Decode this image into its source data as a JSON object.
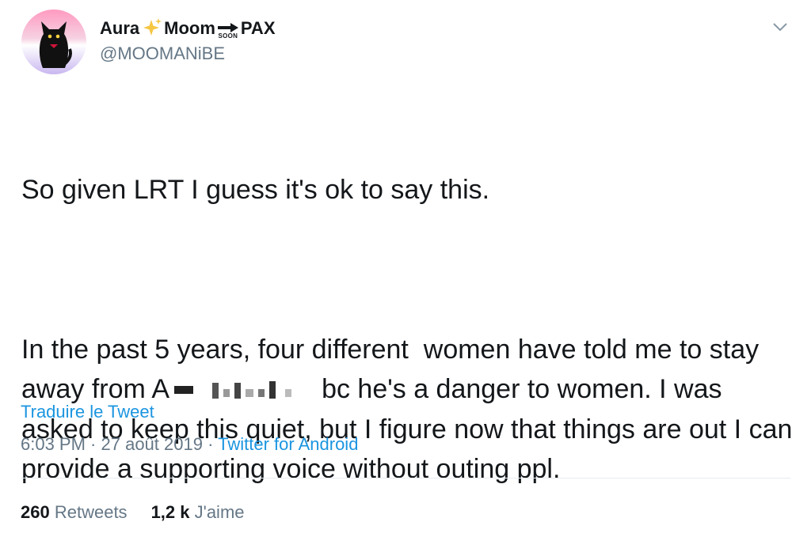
{
  "author": {
    "display_name_part1": "Aura",
    "sparkle_icon": "sparkles-icon",
    "display_name_part2": "Moom",
    "soon_text": "SOON",
    "soon_icon": "soon-arrow-icon",
    "display_name_part3": "PAX",
    "handle": "@MOOMANiBE",
    "avatar_icon": "black-cat-avatar"
  },
  "menu": {
    "icon": "chevron-down-icon"
  },
  "tweet": {
    "line1": "So given LRT I guess it's ok to say this.",
    "para2_before": "In the past 5 years, four different  women have told me to stay away from A",
    "redacted_icon": "redacted-name",
    "para2_after": "bc he's a danger to women. I was asked to keep this quiet, but I figure now that things are out I can provide a supporting voice without outing ppl."
  },
  "translate_label": "Traduire le Tweet",
  "meta": {
    "time": "6:03 PM",
    "sep1": " · ",
    "date": "27 août 2019",
    "sep2": " · ",
    "source": "Twitter for Android"
  },
  "stats": {
    "retweets_count": "260",
    "retweets_label": "Retweets",
    "likes_count": "1,2 k",
    "likes_label": "J'aime"
  },
  "colors": {
    "link": "#1b95e0",
    "secondary": "#657786",
    "text": "#14171a",
    "divider": "#e6ecf0"
  }
}
